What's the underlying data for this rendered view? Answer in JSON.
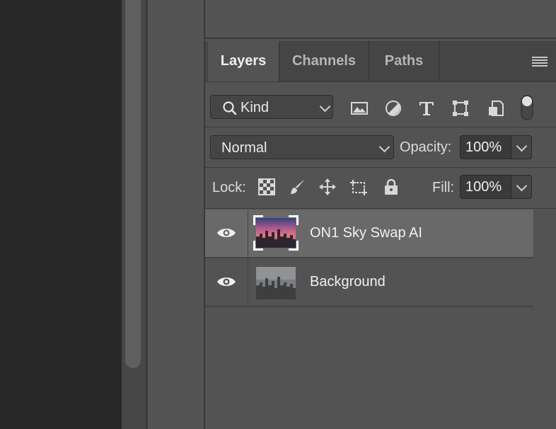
{
  "panel": {
    "tabs": [
      {
        "label": "Layers",
        "active": true
      },
      {
        "label": "Channels",
        "active": false
      },
      {
        "label": "Paths",
        "active": false
      }
    ]
  },
  "filter": {
    "kind_label": "Kind",
    "icons": [
      "image-filter-icon",
      "adjustment-filter-icon",
      "type-filter-icon",
      "shape-filter-icon",
      "smart-object-filter-icon"
    ]
  },
  "blend": {
    "mode": "Normal",
    "opacity_label": "Opacity:",
    "opacity_value": "100%"
  },
  "lock": {
    "label": "Lock:",
    "fill_label": "Fill:",
    "fill_value": "100%"
  },
  "layers": [
    {
      "name": "ON1 Sky Swap AI",
      "visible": true,
      "selected": true,
      "smart_object": true
    },
    {
      "name": "Background",
      "visible": true,
      "selected": false,
      "smart_object": false
    }
  ],
  "colors": {
    "panel_bg": "#535353",
    "selected_row": "#696969",
    "canvas_bg": "#282828"
  }
}
